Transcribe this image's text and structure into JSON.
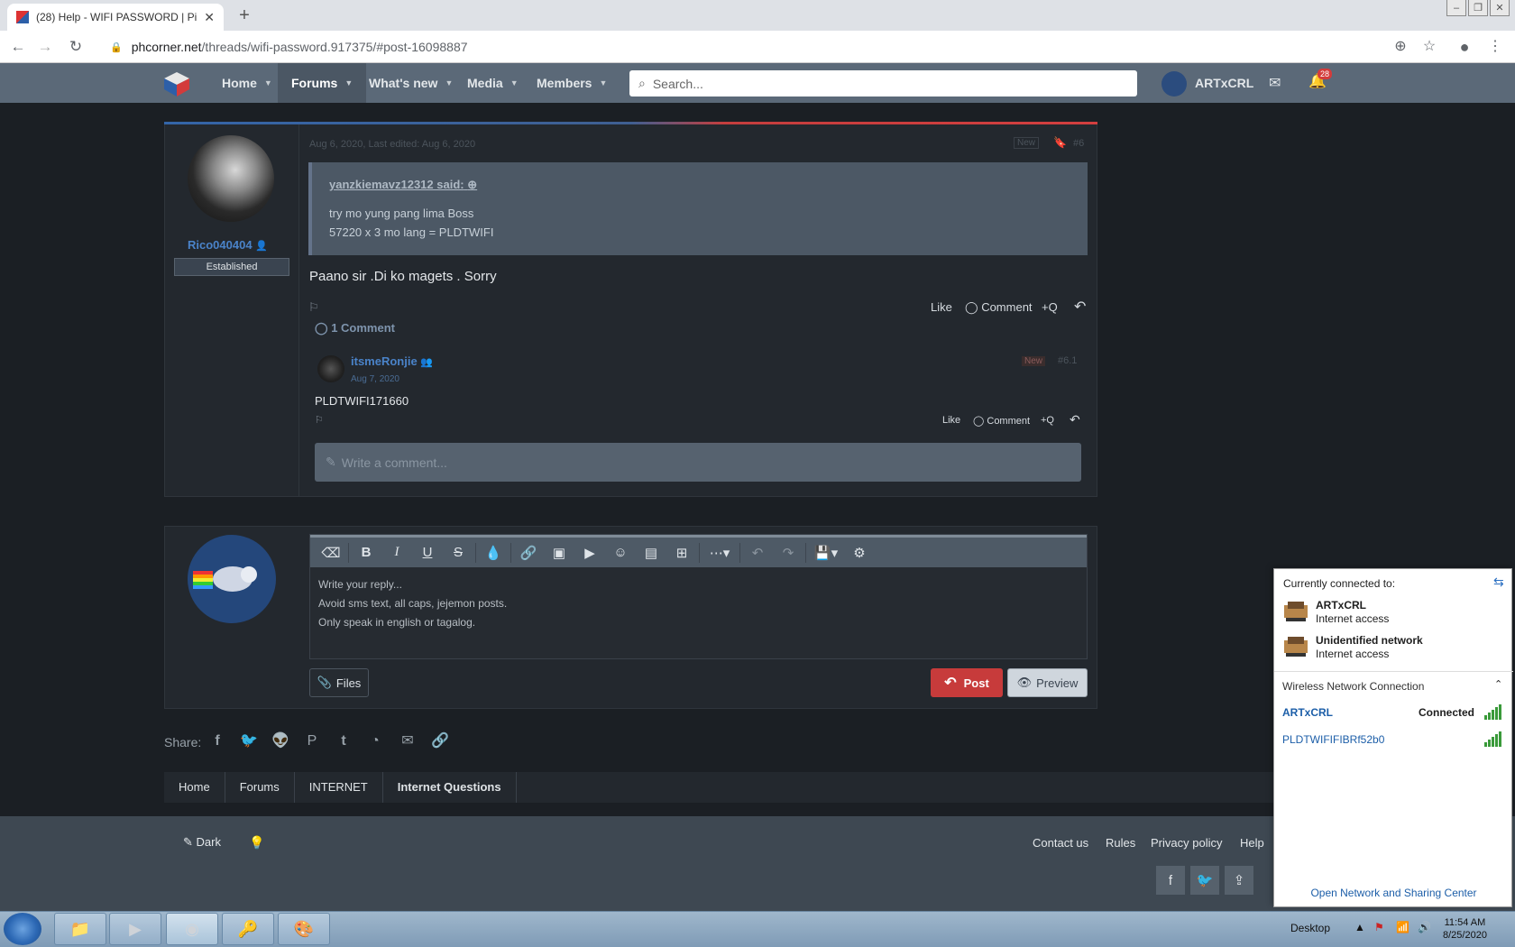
{
  "browser": {
    "tab_title": "(28) Help - WIFI PASSWORD | Pi",
    "url_host": "phcorner.net",
    "url_path": "/threads/wifi-password.917375/#post-16098887"
  },
  "site_nav": {
    "items": [
      "Home",
      "Forums",
      "What's new",
      "Media",
      "Members"
    ],
    "search_placeholder": "Search...",
    "username": "ARTxCRL",
    "notification_count": "28"
  },
  "post": {
    "author": "Rico040404",
    "user_title": "Established",
    "date": "Aug 6, 2020, Last edited: Aug 6, 2020",
    "new_tag": "New",
    "number": "#6",
    "quote_author": "yanzkiemavz12312 said:",
    "quote_line1": "try mo yung pang lima Boss",
    "quote_line2": "57220 x 3 mo lang = PLDTWIFI",
    "body": "Paano sir .Di ko magets . Sorry",
    "actions": {
      "like": "Like",
      "comment": "Comment",
      "quote": "+Q"
    },
    "comments_count": "1 Comment"
  },
  "comment": {
    "author": "itsmeRonjie",
    "date": "Aug 7, 2020",
    "new_tag": "New",
    "number": "#6.1",
    "body": "PLDTWIFI171660",
    "actions": {
      "like": "Like",
      "comment": "Comment",
      "quote": "+Q"
    },
    "write_placeholder": "Write a comment..."
  },
  "reply": {
    "placeholder_line1": "Write your reply...",
    "placeholder_line2": "Avoid sms text, all caps, jejemon posts.",
    "placeholder_line3": "Only speak in english or tagalog.",
    "files_label": "Files",
    "post_label": "Post",
    "preview_label": "Preview"
  },
  "share_label": "Share:",
  "breadcrumb": [
    "Home",
    "Forums",
    "INTERNET",
    "Internet Questions"
  ],
  "footer": {
    "theme_label": "Dark",
    "links": [
      "Contact us",
      "Rules",
      "Privacy policy",
      "Help"
    ]
  },
  "network_popup": {
    "header": "Currently connected to:",
    "connections": [
      {
        "name": "ARTxCRL",
        "status": "Internet access"
      },
      {
        "name": "Unidentified network",
        "status": "Internet access"
      }
    ],
    "section": "Wireless Network Connection",
    "networks": [
      {
        "name": "ARTxCRL",
        "status": "Connected"
      },
      {
        "name": "PLDTWIFIFIBRf52b0",
        "status": ""
      }
    ],
    "open_link": "Open Network and Sharing Center"
  },
  "taskbar": {
    "desktop_label": "Desktop",
    "time": "11:54 AM",
    "date": "8/25/2020"
  },
  "colors": {
    "nav_bg": "#5b6978",
    "page_bg": "#1b1f24",
    "post_button": "#c73b3b",
    "link_blue": "#4a83c9"
  }
}
